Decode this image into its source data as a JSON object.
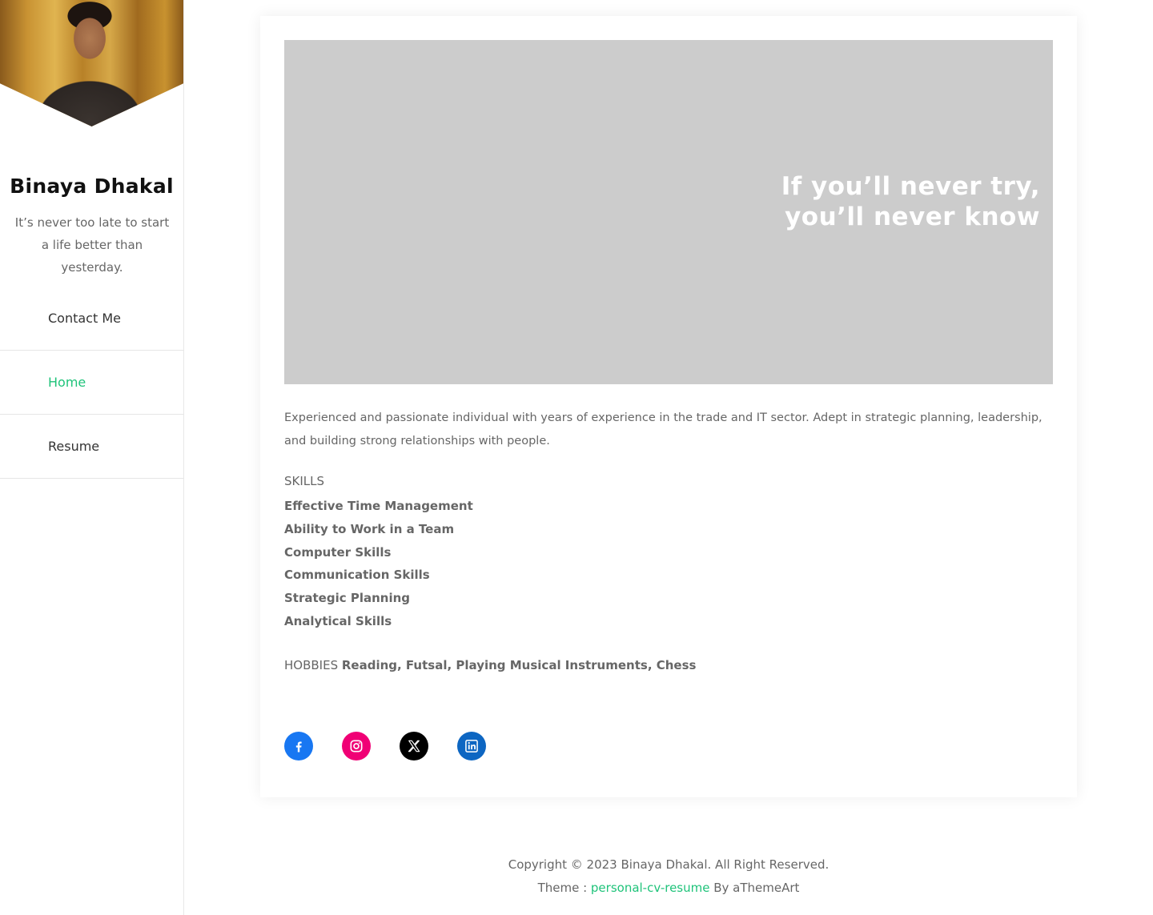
{
  "sidebar": {
    "site_title": "Binaya Dhakal",
    "tagline": "It’s never too late to start a life better than yesterday.",
    "nav": [
      {
        "label": "Contact Me",
        "active": false
      },
      {
        "label": "Home",
        "active": true
      },
      {
        "label": "Resume",
        "active": false
      }
    ]
  },
  "hero": {
    "quote_line1": "If you’ll never try,",
    "quote_line2": "you’ll never know",
    "background": "#cccccc"
  },
  "content": {
    "intro": "Experienced and passionate individual with years of experience in the trade and IT sector. Adept in strategic planning, leadership, and building strong relationships with people.",
    "skills_heading": "SKILLS",
    "skills": [
      "Effective Time Management",
      "Ability to Work in a Team",
      "Computer Skills",
      "Communication Skills",
      "Strategic Planning",
      "Analytical Skills"
    ],
    "hobbies_label": "HOBBIES",
    "hobbies_value": "Reading, Futsal, Playing Musical Instruments, Chess"
  },
  "socials": [
    {
      "name": "facebook-icon",
      "color": "#1877f2"
    },
    {
      "name": "instagram-icon",
      "color": "#f00075"
    },
    {
      "name": "x-icon",
      "color": "#000000"
    },
    {
      "name": "linkedin-icon",
      "color": "#0d66c2"
    }
  ],
  "footer": {
    "copyright": "Copyright © 2023 Binaya Dhakal. All Right Reserved.",
    "theme_prefix": "Theme :",
    "theme_link": "personal-cv-resume",
    "theme_suffix": "By aThemeArt"
  },
  "colors": {
    "accent": "#1fc37a",
    "title": "#111111",
    "body_text": "#666666"
  }
}
